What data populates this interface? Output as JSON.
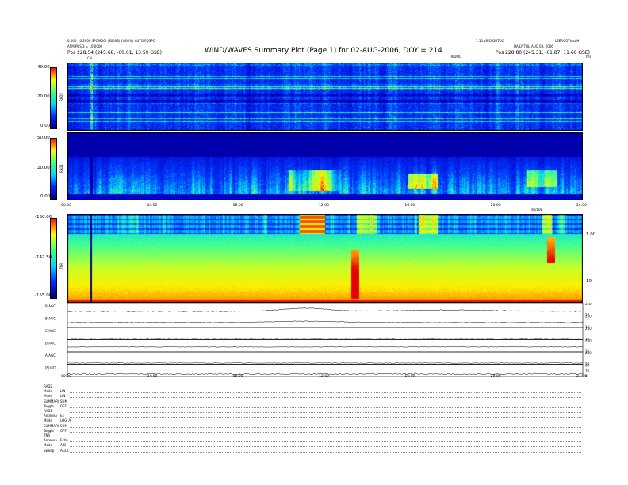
{
  "header": {
    "title": "WIND/WAVES Summary Plot (Page 1) for 02-AUG-2006, DOY = 214",
    "top_left_1": "0.000 - 0.2000 SPCMDGI (S0003) (%00%) AUTO PQSPC",
    "top_left_2": "ASM PRS.3 = 10.0000",
    "pos_left": "Pos   228.54 (245.68, -60.01, 13.59 GSE)",
    "top_right_1": "1.10 VIEO DUTOO",
    "top_right_2": "LEEROOTIcatIH",
    "date_right": "DAILY  THU AUG 03, 2006",
    "pos_right": "Pos   228.80 (245.31, -61.87, 11.66 GSE)",
    "utc_label": "TRIUMC",
    "cal_label": "Cal",
    "right_hrs": "hrs",
    "dbv_label": "db/10E"
  },
  "chart_data": [
    {
      "type": "heatmap",
      "name": "RAD2",
      "ylabel": "RAD2",
      "ylim": [
        0,
        40
      ],
      "yticks": [
        "40.00",
        "20.00",
        "0.00"
      ],
      "xlim": [
        0,
        24
      ]
    },
    {
      "type": "heatmap",
      "name": "RAD1",
      "ylabel": "RAD1",
      "ylim": [
        0,
        50
      ],
      "yticks": [
        "50.00",
        "20.00",
        "0.00"
      ],
      "xlim": [
        0,
        24
      ],
      "xticks": [
        "00:00",
        "04:00",
        "08:00",
        "12:00",
        "16:00",
        "20:00",
        "24:00"
      ]
    },
    {
      "type": "heatmap",
      "name": "TNR",
      "ylabel": "TNR",
      "ylim": [
        -155,
        -130
      ],
      "yticks": [
        "-130.00",
        "-142.50",
        "-155.00"
      ],
      "right_ticks": [
        "1.00",
        "10"
      ],
      "xlim": [
        0,
        24
      ]
    },
    {
      "type": "line",
      "name": "housekeeping",
      "xlim": [
        0,
        24
      ],
      "xticks": [
        "00:00",
        "04:00",
        "08:00",
        "12:00",
        "16:00",
        "20:00",
        "24:00"
      ],
      "series": [
        {
          "name": "B(AGC)",
          "right": [
            "250",
            "10"
          ]
        },
        {
          "name": "B(AGC)",
          "right": [
            "250",
            "10"
          ]
        },
        {
          "name": "C(AGC)",
          "right": [
            "250",
            "10"
          ]
        },
        {
          "name": "B(AGC)",
          "right": [
            "250",
            "10"
          ]
        },
        {
          "name": "A(AGC)",
          "right": [
            "250",
            "10"
          ]
        },
        {
          "name": "|B|(nT)",
          "right": [
            "80",
            "10",
            "0"
          ]
        }
      ]
    }
  ],
  "status": [
    {
      "label": "RAD2",
      "value": ""
    },
    {
      "label": "Mode",
      "value": "LIN"
    },
    {
      "label": "Mode",
      "value": "LIN"
    },
    {
      "label": "SUMMARY",
      "value": "SUM"
    },
    {
      "label": "Toggle",
      "value": "OFF"
    },
    {
      "label": "RAD1",
      "value": ""
    },
    {
      "label": "Antenna",
      "value": "Ex"
    },
    {
      "label": "Mode",
      "value": "LOG_A"
    },
    {
      "label": "SUMMARY",
      "value": "SUM"
    },
    {
      "label": "Toggle",
      "value": "OFF"
    },
    {
      "label": "TNR",
      "value": ""
    },
    {
      "label": "Antenna",
      "value": "Exby"
    },
    {
      "label": "Mode",
      "value": "A/D"
    },
    {
      "label": "Sweep",
      "value": "AGCs"
    }
  ],
  "colors": {
    "navy": "#000080",
    "blue": "#0028ff",
    "cyan": "#00d8ff",
    "green": "#40ff80",
    "yellow": "#ffff00",
    "red": "#ff1000"
  }
}
